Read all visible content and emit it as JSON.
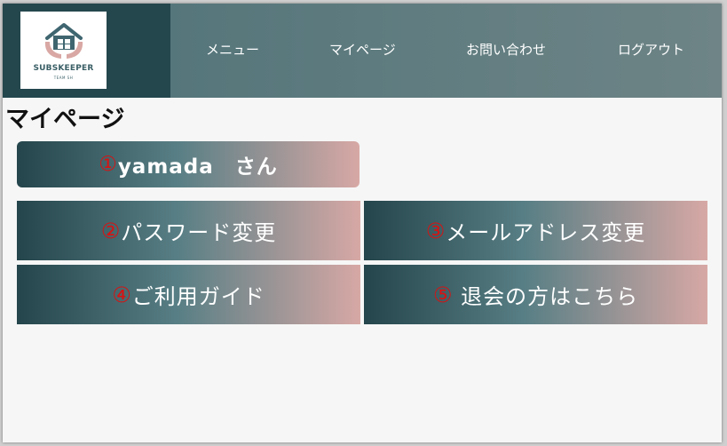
{
  "brand": {
    "name": "SUBSKEEPER",
    "sub": "TEAM SH",
    "colors": {
      "roof": "#3f6670",
      "hands": "#d9a8a4"
    }
  },
  "nav": {
    "items": [
      {
        "label": "メニュー"
      },
      {
        "label": "マイページ"
      },
      {
        "label": "お問い合わせ"
      },
      {
        "label": "ログアウト"
      }
    ]
  },
  "page": {
    "title": "マイページ"
  },
  "user": {
    "number": "①",
    "label": "yamada　さん"
  },
  "actions": [
    {
      "number": "②",
      "label": "パスワード変更"
    },
    {
      "number": "③",
      "label": "メールアドレス変更"
    },
    {
      "number": "④",
      "label": "ご利用ガイド"
    },
    {
      "number": "⑤",
      "label": " 退会の方はこちら"
    }
  ],
  "colors": {
    "header_dark": "#24474d",
    "nav_bg": "#607c80",
    "gradient": [
      "#24454b",
      "#587f85",
      "#d7a8a5"
    ],
    "number_red": "#d71313"
  }
}
